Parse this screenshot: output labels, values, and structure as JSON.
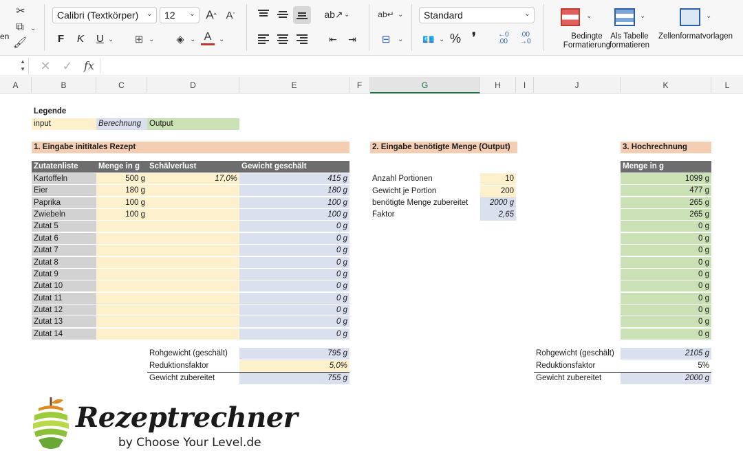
{
  "ribbon": {
    "cut_partial_label": "en",
    "font_name": "Calibri (Textkörper)",
    "font_size": "12",
    "bold": "F",
    "italic": "K",
    "underline": "U",
    "number_format": "Standard",
    "percent": "%",
    "comma": "❜",
    "dec_inc": ".00",
    "dec_dec": ".00",
    "cond_format_label_1": "Bedingte",
    "cond_format_label_2": "Formatierung",
    "as_table_label_1": "Als Tabelle",
    "as_table_label_2": "formatieren",
    "cell_styles_label": "Zellenformatvorlagen"
  },
  "formula_bar": {
    "fx": "fx",
    "value": ""
  },
  "columns": [
    "A",
    "B",
    "C",
    "D",
    "E",
    "F",
    "G",
    "H",
    "I",
    "J",
    "K",
    "L"
  ],
  "selected_column": "G",
  "legend": {
    "title": "Legende",
    "input": "input",
    "calc": "Berechnung",
    "output": "Output"
  },
  "section1": {
    "title": "1. Eingabe inititales Rezept",
    "headers": [
      "Zutatenliste",
      "Menge in g",
      "Schälverlust",
      "Gewicht geschält"
    ],
    "rows": [
      {
        "name": "Kartoffeln",
        "amount": "500 g",
        "loss": "17,0%",
        "peeled": "415 g"
      },
      {
        "name": "Eier",
        "amount": "180 g",
        "loss": "",
        "peeled": "180 g"
      },
      {
        "name": "Paprika",
        "amount": "100 g",
        "loss": "",
        "peeled": "100 g"
      },
      {
        "name": "Zwiebeln",
        "amount": "100 g",
        "loss": "",
        "peeled": "100 g"
      },
      {
        "name": "Zutat 5",
        "amount": "",
        "loss": "",
        "peeled": "0 g"
      },
      {
        "name": "Zutat 6",
        "amount": "",
        "loss": "",
        "peeled": "0 g"
      },
      {
        "name": "Zutat 7",
        "amount": "",
        "loss": "",
        "peeled": "0 g"
      },
      {
        "name": "Zutat 8",
        "amount": "",
        "loss": "",
        "peeled": "0 g"
      },
      {
        "name": "Zutat 9",
        "amount": "",
        "loss": "",
        "peeled": "0 g"
      },
      {
        "name": "Zutat 10",
        "amount": "",
        "loss": "",
        "peeled": "0 g"
      },
      {
        "name": "Zutat 11",
        "amount": "",
        "loss": "",
        "peeled": "0 g"
      },
      {
        "name": "Zutat 12",
        "amount": "",
        "loss": "",
        "peeled": "0 g"
      },
      {
        "name": "Zutat 13",
        "amount": "",
        "loss": "",
        "peeled": "0 g"
      },
      {
        "name": "Zutat 14",
        "amount": "",
        "loss": "",
        "peeled": "0 g"
      }
    ],
    "summary": [
      {
        "label": "Rohgewicht (geschält)",
        "value": "795 g"
      },
      {
        "label": "Reduktionsfaktor",
        "value": "5,0%"
      },
      {
        "label": "Gewicht zubereitet",
        "value": "755 g"
      }
    ]
  },
  "section2": {
    "title": "2. Eingabe benötigte Menge (Output)",
    "rows": [
      {
        "label": "Anzahl Portionen",
        "value": "10"
      },
      {
        "label": "Gewicht je Portion",
        "value": "200"
      },
      {
        "label": "benötigte Menge zubereitet",
        "value": "2000 g"
      },
      {
        "label": "Faktor",
        "value": "2,65"
      }
    ]
  },
  "section3": {
    "title": "3. Hochrechnung",
    "header": "Menge in g",
    "values": [
      "1099 g",
      "477 g",
      "265 g",
      "265 g",
      "0 g",
      "0 g",
      "0 g",
      "0 g",
      "0 g",
      "0 g",
      "0 g",
      "0 g",
      "0 g",
      "0 g"
    ],
    "summary": [
      {
        "label": "Rohgewicht (geschält)",
        "value": "2105 g"
      },
      {
        "label": "Reduktionsfaktor",
        "value": "5%"
      },
      {
        "label": "Gewicht zubereitet",
        "value": "2000 g"
      }
    ]
  },
  "logo": {
    "wordmark": "Rezeptrechner",
    "byline": "by  Choose Your Level.de"
  },
  "colors": {
    "input": "#fdf0cc",
    "calc": "#dbe0ef",
    "output": "#c9e1b5",
    "section_header": "#f4cdb3",
    "table_header": "#6d6d6d"
  }
}
